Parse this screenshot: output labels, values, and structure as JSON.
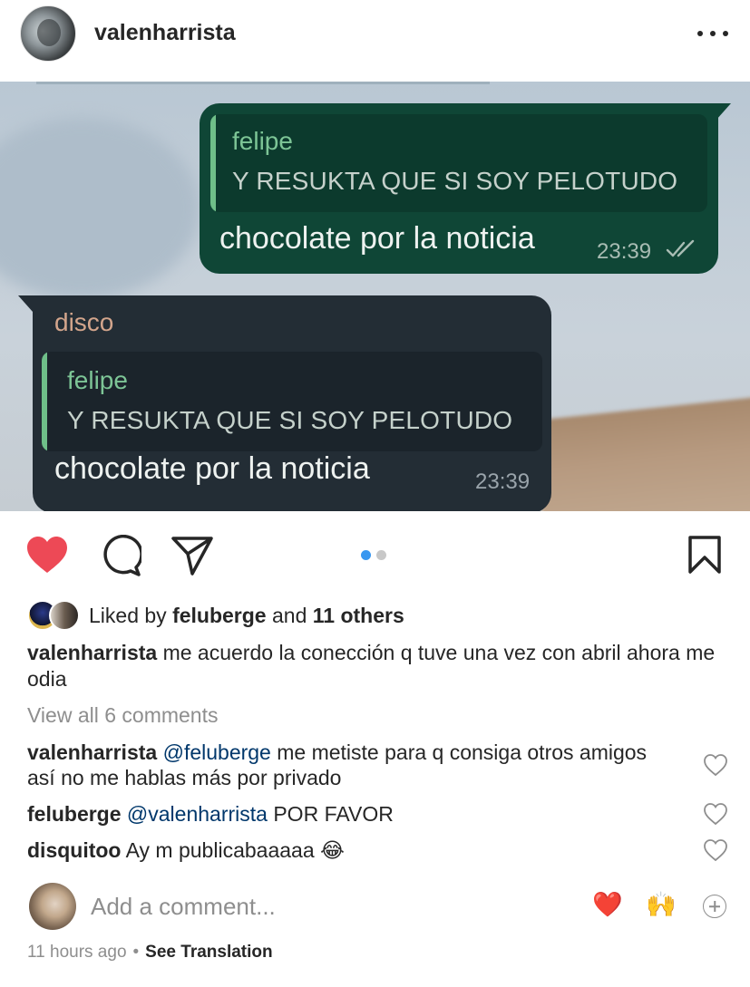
{
  "header": {
    "username": "valenharrista",
    "avatar_icon": "profile-avatar",
    "more_icon": "more-horizontal-icon"
  },
  "image": {
    "sent_message": {
      "quote_name": "felipe",
      "quote_text": "Y RESUKTA QUE SI SOY PELOTUDO",
      "text": "chocolate por la noticia",
      "time": "23:39",
      "status_icon": "double-check-icon"
    },
    "received_message": {
      "sender": "disco",
      "quote_name": "felipe",
      "quote_text": "Y RESUKTA QUE SI SOY PELOTUDO",
      "text": "chocolate por la noticia",
      "time": "23:39"
    },
    "carousel": {
      "total": 2,
      "current": 1
    }
  },
  "actions": {
    "like_icon": "heart-filled-icon",
    "comment_icon": "comment-bubble-icon",
    "share_icon": "paper-plane-icon",
    "save_icon": "bookmark-icon",
    "liked": true
  },
  "likes": {
    "prefix": "Liked by ",
    "user": "feluberge",
    "middle": " and ",
    "others": "11 others"
  },
  "caption": {
    "username": "valenharrista",
    "text": "me acuerdo la conección q tuve una vez con abril ahora me odia"
  },
  "view_all_comments": "View all 6 comments",
  "comments": [
    {
      "username": "valenharrista",
      "mention": "@feluberge",
      "text": "me metiste para q consiga otros amigos así no me hablas más por privado"
    },
    {
      "username": "feluberge",
      "mention": "@valenharrista",
      "text": "POR FAVOR"
    },
    {
      "username": "disquitoo",
      "mention": "",
      "text": "Ay m publicabaaaaa 😂"
    }
  ],
  "add_comment": {
    "placeholder": "Add a comment...",
    "emoji_1": "❤️",
    "emoji_2": "🙌"
  },
  "meta": {
    "time_ago": "11 hours ago",
    "separator": "•",
    "see_translation": "See Translation"
  },
  "colors": {
    "like_red": "#ed4956",
    "mention_blue": "#00376b",
    "carousel_active": "#3897f0",
    "sent_bubble": "#0f4636",
    "received_bubble": "#232d35"
  }
}
